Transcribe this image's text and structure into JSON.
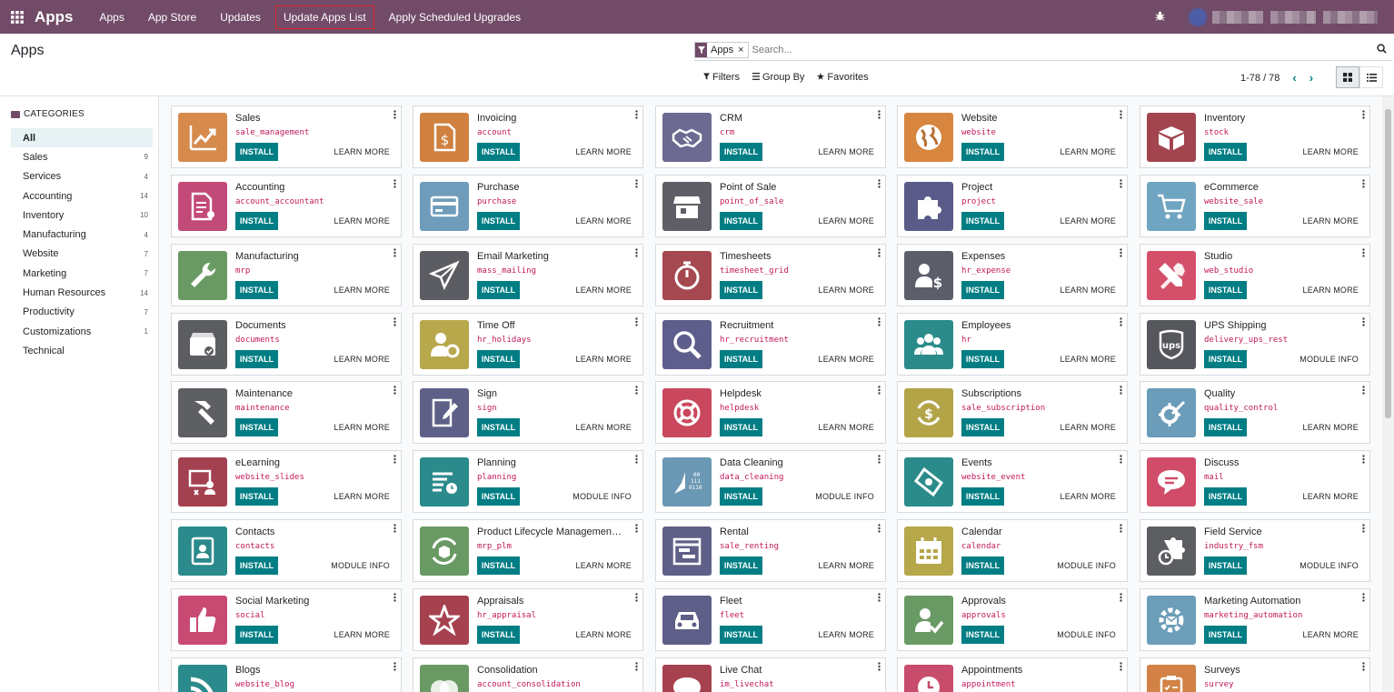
{
  "navbar": {
    "app_title": "Apps",
    "menu": [
      "Apps",
      "App Store",
      "Updates",
      "Update Apps List",
      "Apply Scheduled Upgrades"
    ]
  },
  "control_panel": {
    "breadcrumb": "Apps",
    "facet_value": "Apps",
    "facet_remove": "×",
    "search_placeholder": "Search...",
    "filters_label": "Filters",
    "groupby_label": "Group By",
    "favorites_label": "Favorites",
    "pager": "1-78 / 78"
  },
  "sidebar": {
    "header": "CATEGORIES",
    "items": [
      {
        "label": "All",
        "count": ""
      },
      {
        "label": "Sales",
        "count": "9"
      },
      {
        "label": "Services",
        "count": "4"
      },
      {
        "label": "Accounting",
        "count": "14"
      },
      {
        "label": "Inventory",
        "count": "10"
      },
      {
        "label": "Manufacturing",
        "count": "4"
      },
      {
        "label": "Website",
        "count": "7"
      },
      {
        "label": "Marketing",
        "count": "7"
      },
      {
        "label": "Human Resources",
        "count": "14"
      },
      {
        "label": "Productivity",
        "count": "7"
      },
      {
        "label": "Customizations",
        "count": "1"
      },
      {
        "label": "Technical",
        "count": ""
      }
    ]
  },
  "install_label": "INSTALL",
  "apps": [
    {
      "name": "Sales",
      "tech": "sale_management",
      "action": "LEARN MORE",
      "color": "#d68a4c",
      "icon": "chart-up-icon"
    },
    {
      "name": "Invoicing",
      "tech": "account",
      "action": "LEARN MORE",
      "color": "#d08140",
      "icon": "invoice-dollar-icon"
    },
    {
      "name": "CRM",
      "tech": "crm",
      "action": "LEARN MORE",
      "color": "#6c6a91",
      "icon": "handshake-icon"
    },
    {
      "name": "Website",
      "tech": "website",
      "action": "LEARN MORE",
      "color": "#d8863f",
      "icon": "globe-icon"
    },
    {
      "name": "Inventory",
      "tech": "stock",
      "action": "LEARN MORE",
      "color": "#a2454f",
      "icon": "box-icon"
    },
    {
      "name": "Accounting",
      "tech": "account_accountant",
      "action": "LEARN MORE",
      "color": "#c24a78",
      "icon": "document-gear-icon"
    },
    {
      "name": "Purchase",
      "tech": "purchase",
      "action": "LEARN MORE",
      "color": "#6f9cbb",
      "icon": "credit-card-icon"
    },
    {
      "name": "Point of Sale",
      "tech": "point_of_sale",
      "action": "LEARN MORE",
      "color": "#5f5e66",
      "icon": "shop-icon"
    },
    {
      "name": "Project",
      "tech": "project",
      "action": "LEARN MORE",
      "color": "#5a5b88",
      "icon": "puzzle-icon"
    },
    {
      "name": "eCommerce",
      "tech": "website_sale",
      "action": "LEARN MORE",
      "color": "#70a5c1",
      "icon": "cart-icon"
    },
    {
      "name": "Manufacturing",
      "tech": "mrp",
      "action": "LEARN MORE",
      "color": "#6a9a63",
      "icon": "wrench-icon"
    },
    {
      "name": "Email Marketing",
      "tech": "mass_mailing",
      "action": "LEARN MORE",
      "color": "#5b5d63",
      "icon": "paper-plane-icon"
    },
    {
      "name": "Timesheets",
      "tech": "timesheet_grid",
      "action": "LEARN MORE",
      "color": "#a54850",
      "icon": "stopwatch-icon"
    },
    {
      "name": "Expenses",
      "tech": "hr_expense",
      "action": "LEARN MORE",
      "color": "#5c5f6a",
      "icon": "user-dollar-icon"
    },
    {
      "name": "Studio",
      "tech": "web_studio",
      "action": "LEARN MORE",
      "color": "#d4506a",
      "icon": "tools-icon"
    },
    {
      "name": "Documents",
      "tech": "documents",
      "action": "LEARN MORE",
      "color": "#5b5d60",
      "icon": "inbox-check-icon"
    },
    {
      "name": "Time Off",
      "tech": "hr_holidays",
      "action": "LEARN MORE",
      "color": "#b8a84c",
      "icon": "user-gear-icon"
    },
    {
      "name": "Recruitment",
      "tech": "hr_recruitment",
      "action": "LEARN MORE",
      "color": "#5d5e8b",
      "icon": "magnifier-icon"
    },
    {
      "name": "Employees",
      "tech": "hr",
      "action": "LEARN MORE",
      "color": "#2b8b8a",
      "icon": "users-icon"
    },
    {
      "name": "UPS Shipping",
      "tech": "delivery_ups_rest",
      "action": "MODULE INFO",
      "color": "#55575c",
      "icon": "ups-shield-icon"
    },
    {
      "name": "Maintenance",
      "tech": "maintenance",
      "action": "LEARN MORE",
      "color": "#5d5f63",
      "icon": "hammer-icon"
    },
    {
      "name": "Sign",
      "tech": "sign",
      "action": "LEARN MORE",
      "color": "#5f6088",
      "icon": "sign-pen-icon"
    },
    {
      "name": "Helpdesk",
      "tech": "helpdesk",
      "action": "LEARN MORE",
      "color": "#c9485d",
      "icon": "lifebuoy-icon"
    },
    {
      "name": "Subscriptions",
      "tech": "sale_subscription",
      "action": "LEARN MORE",
      "color": "#b3a448",
      "icon": "recurring-dollar-icon"
    },
    {
      "name": "Quality",
      "tech": "quality_control",
      "action": "LEARN MORE",
      "color": "#6b9cb9",
      "icon": "quality-gear-icon"
    },
    {
      "name": "eLearning",
      "tech": "website_slides",
      "action": "LEARN MORE",
      "color": "#a34150",
      "icon": "presentation-icon"
    },
    {
      "name": "Planning",
      "tech": "planning",
      "action": "MODULE INFO",
      "color": "#2b8a8b",
      "icon": "planning-clock-icon"
    },
    {
      "name": "Data Cleaning",
      "tech": "data_cleaning",
      "action": "MODULE INFO",
      "color": "#6b98b4",
      "icon": "broom-binary-icon"
    },
    {
      "name": "Events",
      "tech": "website_event",
      "action": "LEARN MORE",
      "color": "#2b8b8a",
      "icon": "ticket-icon"
    },
    {
      "name": "Discuss",
      "tech": "mail",
      "action": "LEARN MORE",
      "color": "#d14c69",
      "icon": "chat-bubble-icon"
    },
    {
      "name": "Contacts",
      "tech": "contacts",
      "action": "MODULE INFO",
      "color": "#2b8a8b",
      "icon": "address-book-icon"
    },
    {
      "name": "Product Lifecycle Management (...",
      "tech": "mrp_plm",
      "action": "LEARN MORE",
      "color": "#6a9a64",
      "icon": "cycle-box-icon"
    },
    {
      "name": "Rental",
      "tech": "sale_renting",
      "action": "LEARN MORE",
      "color": "#5f6087",
      "icon": "calendar-grid-icon"
    },
    {
      "name": "Calendar",
      "tech": "calendar",
      "action": "MODULE INFO",
      "color": "#b6a74b",
      "icon": "calendar-icon"
    },
    {
      "name": "Field Service",
      "tech": "industry_fsm",
      "action": "MODULE INFO",
      "color": "#5c5e62",
      "icon": "puzzle-clock-icon"
    },
    {
      "name": "Social Marketing",
      "tech": "social",
      "action": "LEARN MORE",
      "color": "#c84a72",
      "icon": "thumbs-up-icon"
    },
    {
      "name": "Appraisals",
      "tech": "hr_appraisal",
      "action": "LEARN MORE",
      "color": "#a6414f",
      "icon": "star-icon"
    },
    {
      "name": "Fleet",
      "tech": "fleet",
      "action": "LEARN MORE",
      "color": "#5d5f88",
      "icon": "car-icon"
    },
    {
      "name": "Approvals",
      "tech": "approvals",
      "action": "MODULE INFO",
      "color": "#6a9a64",
      "icon": "user-check-icon"
    },
    {
      "name": "Marketing Automation",
      "tech": "marketing_automation",
      "action": "LEARN MORE",
      "color": "#6c9db9",
      "icon": "gear-mail-icon"
    },
    {
      "name": "Blogs",
      "tech": "website_blog",
      "action": "",
      "color": "#2b8a8b",
      "icon": "rss-icon"
    },
    {
      "name": "Consolidation",
      "tech": "account_consolidation",
      "action": "",
      "color": "#6a9a64",
      "icon": "circles-icon"
    },
    {
      "name": "Live Chat",
      "tech": "im_livechat",
      "action": "",
      "color": "#a64150",
      "icon": "livechat-icon"
    },
    {
      "name": "Appointments",
      "tech": "appointment",
      "action": "",
      "color": "#c84c6b",
      "icon": "appointment-icon"
    },
    {
      "name": "Surveys",
      "tech": "survey",
      "action": "",
      "color": "#d18244",
      "icon": "clipboard-icon"
    }
  ]
}
